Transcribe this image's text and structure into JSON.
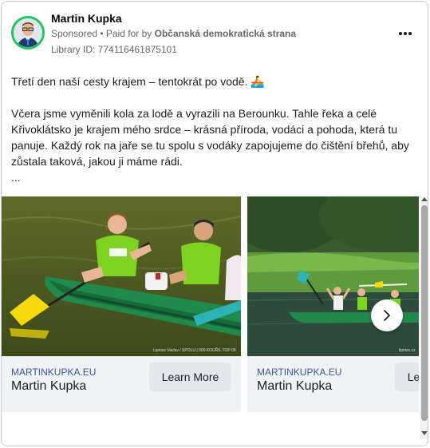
{
  "advertiser": {
    "name": "Martin Kupka",
    "sponsored": "Sponsored",
    "paid_prefix": " • Paid for by ",
    "paid_by": "Občanská demokratická strana",
    "library_id": "Library ID: 774116461875101"
  },
  "post": {
    "line1": "Třetí den naší cesty krajem – tentokrát po vodě. 🚣",
    "paragraph": "Včera jsme vyměnili kola za lodě a vyrazili na Berounku. Tahle řeka a celé Křivoklátsko je krajem mého srdce – krásná příroda, vodáci a pohoda, která tu panuje. Každý rok na jaře se tu spolu s vodáky zapojujeme do čištění břehů, aby zůstala taková, jakou ji máme rádi.",
    "ellipsis": "..."
  },
  "cards": [
    {
      "domain": "MARTINKUPKA.EU",
      "title": "Martin Kupka",
      "cta": "Learn More",
      "photo_credit": "Lipnice Vaclav / SPOLU | 000 KOUŘIL TOP 09"
    },
    {
      "domain": "MARTINKUPKA.EU",
      "title": "Martin Kupka",
      "cta": "Learn More",
      "photo_credit": "lipnice.cz"
    }
  ],
  "icons": {
    "more": "more-horizontal-icon",
    "next": "chevron-right-icon"
  },
  "colors": {
    "avatar_ring": "#22c55e",
    "link": "#385898",
    "button_bg": "#e4e6eb",
    "footer_bg": "#f0f2f5"
  }
}
